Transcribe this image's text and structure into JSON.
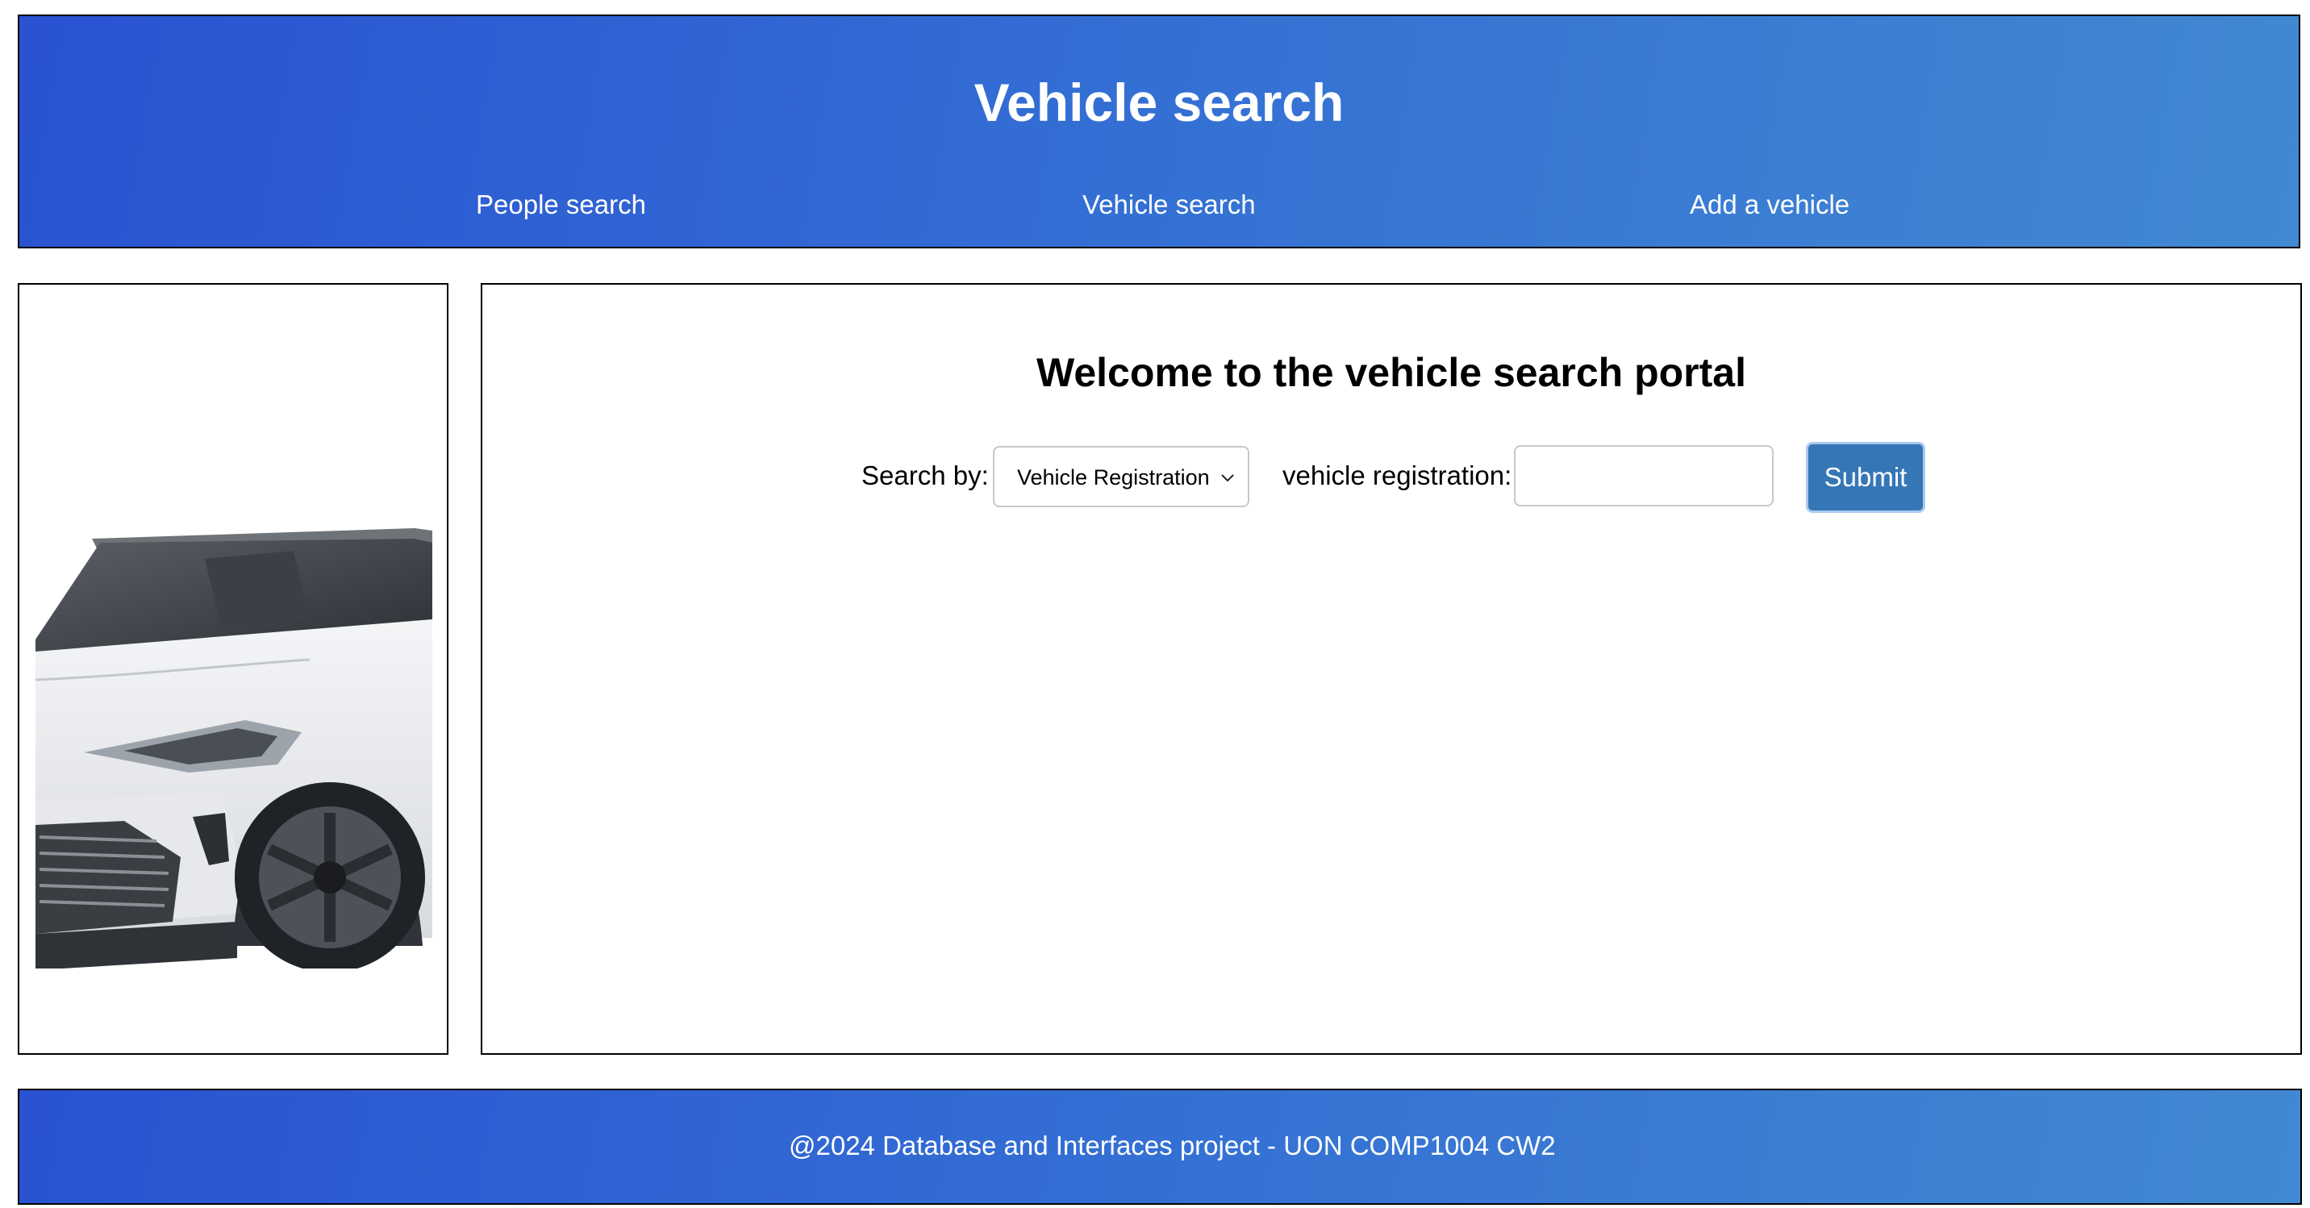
{
  "header": {
    "title": "Vehicle search",
    "nav": [
      {
        "label": "People search"
      },
      {
        "label": "Vehicle search"
      },
      {
        "label": "Add a vehicle"
      }
    ]
  },
  "sidebar": {
    "image_icon": "car-photo"
  },
  "main": {
    "heading": "Welcome to the vehicle search portal",
    "search_by_label": "Search by:",
    "search_by_selected": "Vehicle Registration",
    "registration_label": "vehicle registration:",
    "registration_value": "",
    "submit_label": "Submit"
  },
  "footer": {
    "text": "@2024 Database and Interfaces project - UON COMP1004 CW2"
  },
  "colors": {
    "header_gradient_start": "#2a52d2",
    "header_gradient_end": "#4189d2",
    "submit_bg": "#3576b6",
    "border": "#000000"
  }
}
